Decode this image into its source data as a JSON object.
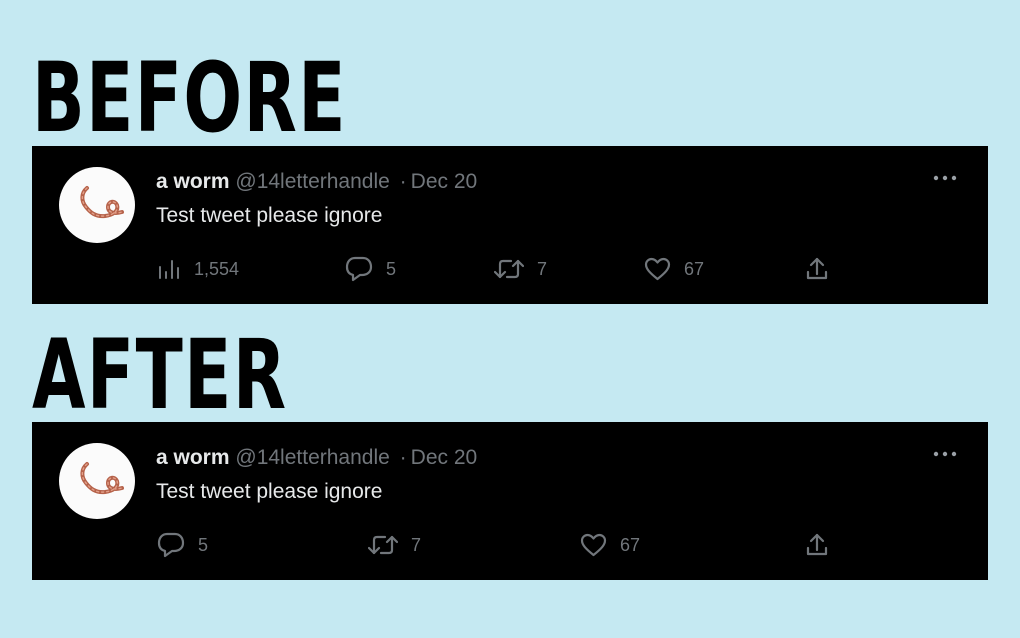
{
  "before": {
    "heading": "BEFORE",
    "tweet": {
      "author_name": "a worm",
      "handle": "@14letterhandle",
      "separator": "·",
      "date": "Dec 20",
      "text": "Test tweet please ignore",
      "views": "1,554",
      "replies": "5",
      "retweets": "7",
      "likes": "67"
    }
  },
  "after": {
    "heading": "AFTER",
    "tweet": {
      "author_name": "a worm",
      "handle": "@14letterhandle",
      "separator": "·",
      "date": "Dec 20",
      "text": "Test tweet please ignore",
      "replies": "5",
      "retweets": "7",
      "likes": "67"
    }
  },
  "icons": {
    "views": "bar-chart-icon",
    "reply": "reply-bubble-icon",
    "retweet": "retweet-icon",
    "like": "heart-icon",
    "share": "share-icon",
    "more": "more-options-icon"
  },
  "colors": {
    "background": "#c5e9f2",
    "tweet_background": "#000000",
    "primary_text": "#e7e9ea",
    "secondary_text": "#71767b",
    "worm": "#b5624a"
  }
}
